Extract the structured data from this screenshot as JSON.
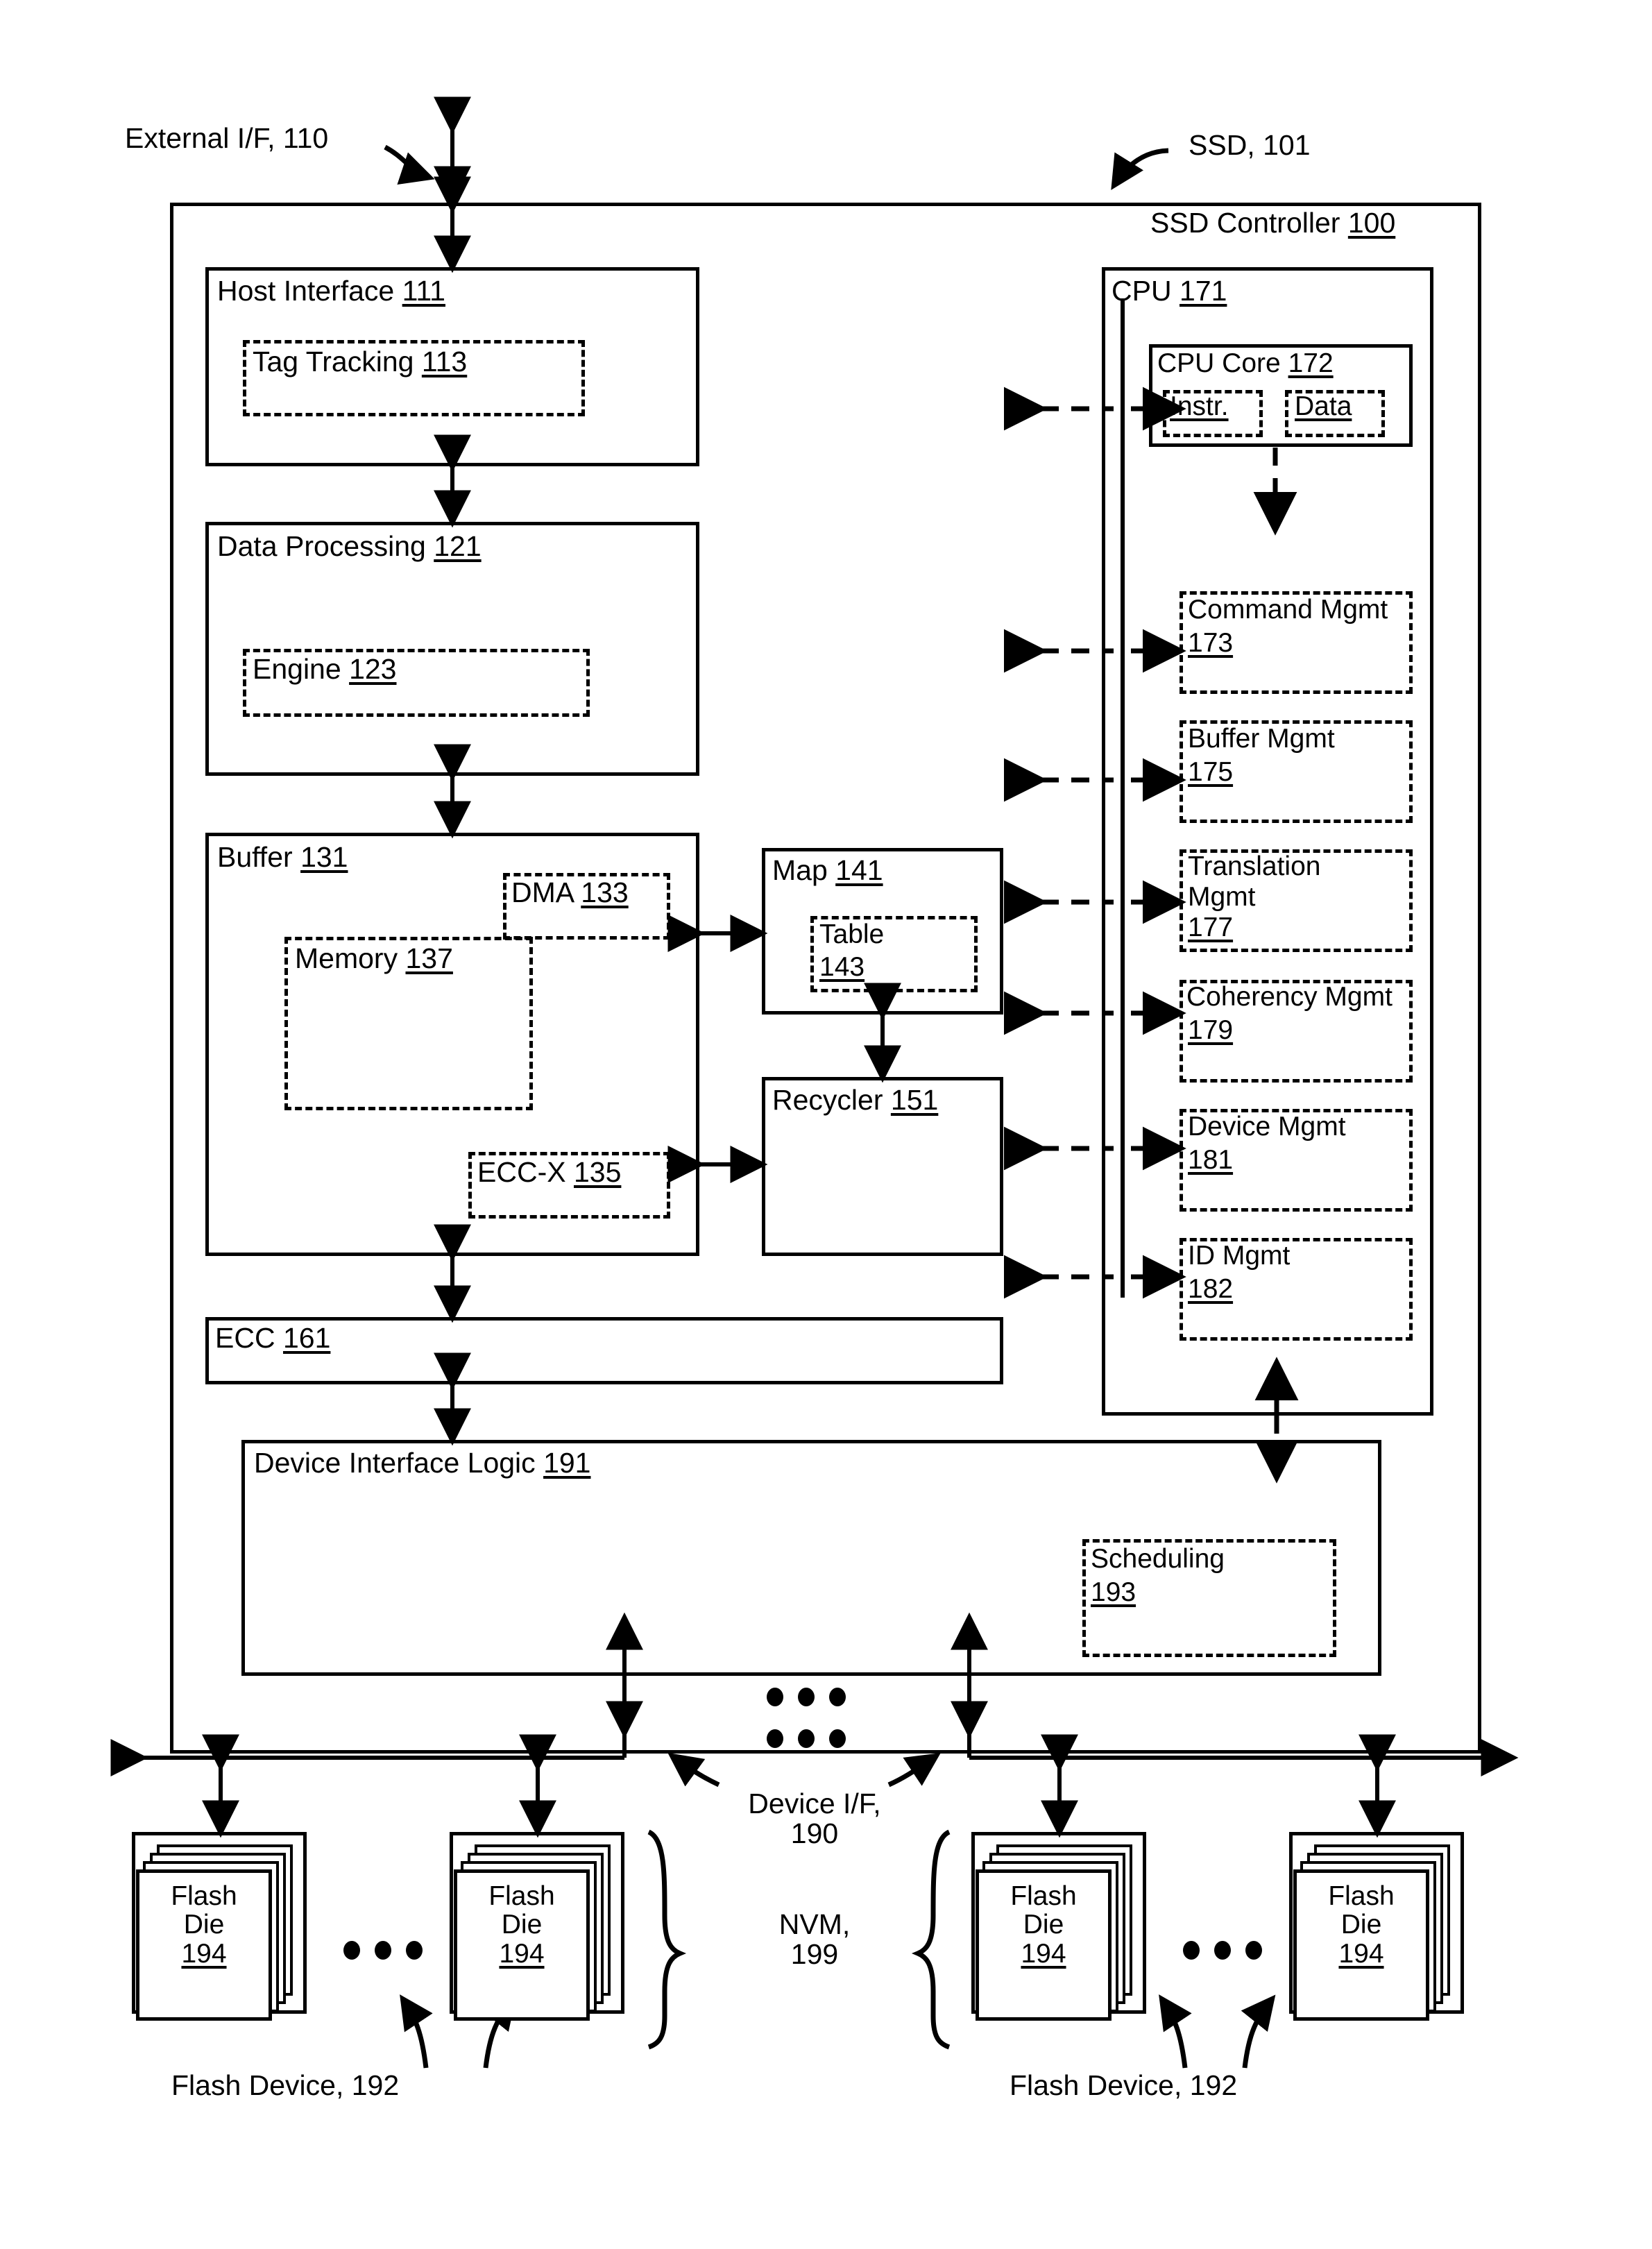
{
  "figure": {
    "external_if": {
      "label": "External I/F, 110"
    },
    "ssd": {
      "label": "SSD, 101"
    },
    "ssd_controller": {
      "title": "SSD Controller",
      "ref": "100"
    },
    "host_interface": {
      "title": "Host Interface",
      "ref": "111",
      "tag_tracking": {
        "title": "Tag Tracking",
        "ref": "113"
      }
    },
    "data_processing": {
      "title": "Data Processing",
      "ref": "121",
      "engine": {
        "title": "Engine",
        "ref": "123"
      }
    },
    "buffer": {
      "title": "Buffer",
      "ref": "131",
      "dma": {
        "title": "DMA",
        "ref": "133"
      },
      "memory": {
        "title": "Memory",
        "ref": "137"
      },
      "eccx": {
        "title": "ECC-X",
        "ref": "135"
      }
    },
    "map": {
      "title": "Map",
      "ref": "141",
      "table": {
        "title": "Table",
        "ref": "143"
      }
    },
    "recycler": {
      "title": "Recycler",
      "ref": "151"
    },
    "ecc": {
      "title": "ECC",
      "ref": "161"
    },
    "device_interface_logic": {
      "title": "Device Interface Logic",
      "ref": "191",
      "scheduling": {
        "title": "Scheduling",
        "ref": "193"
      }
    },
    "cpu": {
      "title": "CPU",
      "ref": "171",
      "core": {
        "title": "CPU Core",
        "ref": "172",
        "instr": {
          "title": "Instr."
        },
        "data": {
          "title": "Data"
        }
      },
      "modules": [
        {
          "title": "Command Mgmt",
          "ref": "173"
        },
        {
          "title": "Buffer Mgmt",
          "ref": "175"
        },
        {
          "title": "Translation",
          "title2": "Mgmt",
          "ref": "177"
        },
        {
          "title": "Coherency Mgmt",
          "ref": "179"
        },
        {
          "title": "Device Mgmt",
          "ref": "181"
        },
        {
          "title": "ID Mgmt",
          "ref": "182"
        }
      ]
    },
    "device_if": {
      "line1": "Device I/F,",
      "line2": "190"
    },
    "nvm": {
      "line1": "NVM,",
      "line2": "199"
    },
    "flash_device_left": {
      "label": "Flash Device, 192"
    },
    "flash_device_right": {
      "label": "Flash Device, 192"
    },
    "flash_dies": [
      {
        "line1": "Flash",
        "line2": "Die",
        "ref": "194"
      },
      {
        "line1": "Flash",
        "line2": "Die",
        "ref": "194"
      },
      {
        "line1": "Flash",
        "line2": "Die",
        "ref": "194"
      },
      {
        "line1": "Flash",
        "line2": "Die",
        "ref": "194"
      }
    ]
  },
  "colors": {
    "ink": "#000000",
    "paper": "#ffffff"
  }
}
